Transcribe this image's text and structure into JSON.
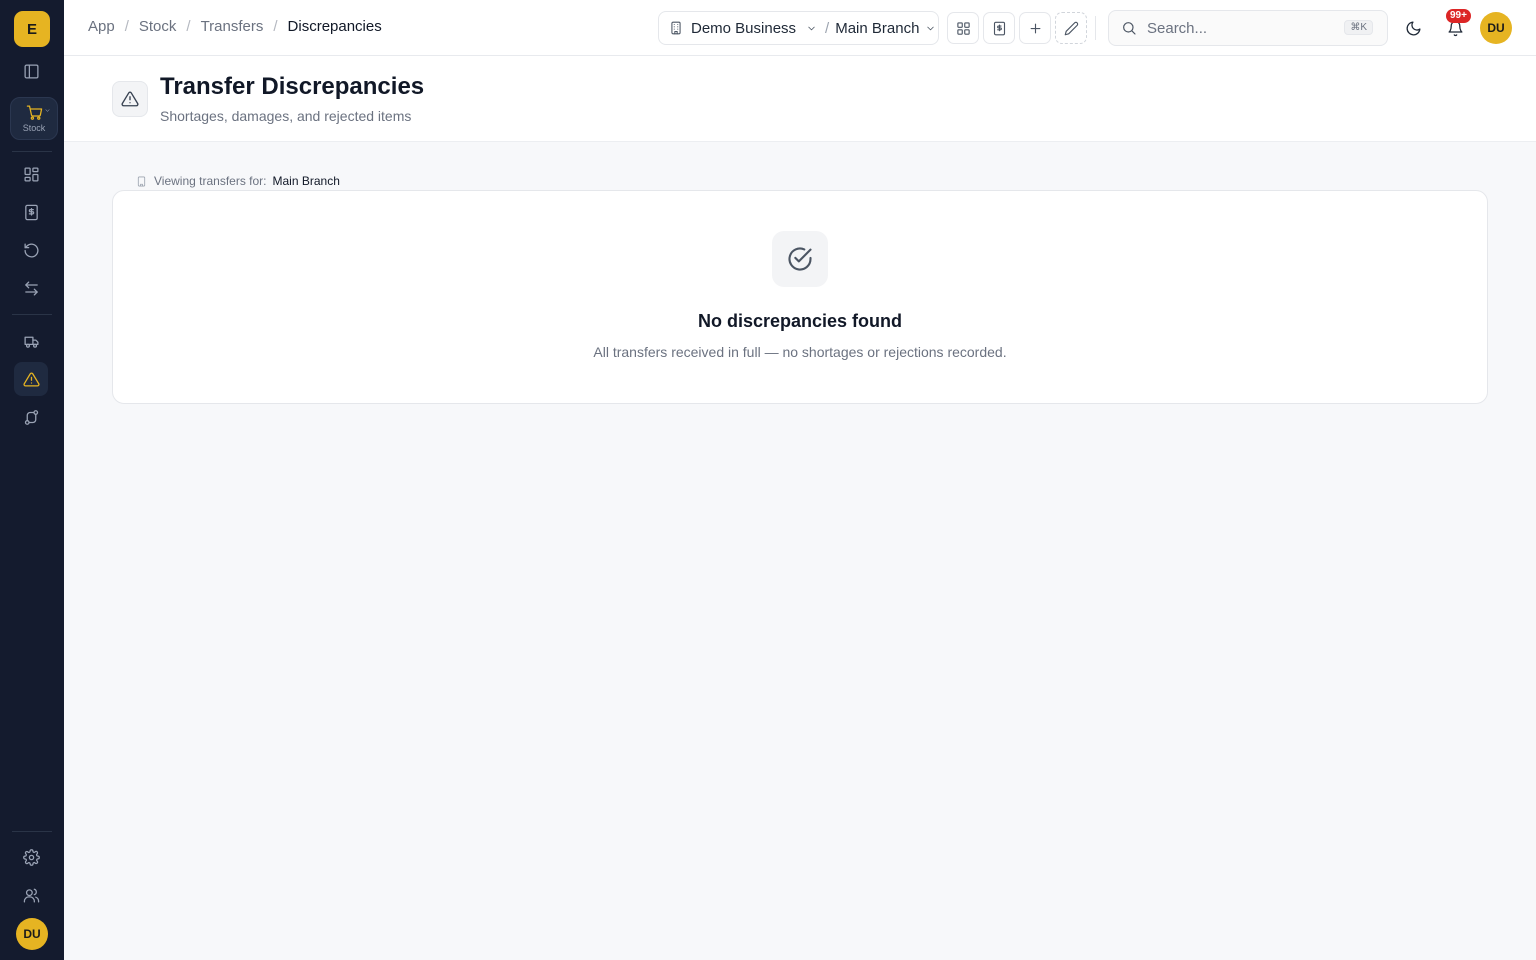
{
  "app": {
    "logo_letter": "E",
    "user_initials": "DU",
    "accent_color": "#e6b422",
    "sidebar_color": "#141b2e"
  },
  "sidebar": {
    "module_label": "Stock",
    "items": [
      {
        "icon": "panel-toggle-icon"
      },
      {
        "icon": "dashboard-grid-icon"
      },
      {
        "icon": "receipt-icon"
      },
      {
        "icon": "history-icon"
      },
      {
        "icon": "transfer-arrows-icon"
      },
      {
        "icon": "truck-icon"
      },
      {
        "icon": "alert-triangle-icon",
        "active": true
      },
      {
        "icon": "route-icon"
      },
      {
        "icon": "settings-gear-icon"
      },
      {
        "icon": "users-icon"
      }
    ]
  },
  "topbar": {
    "breadcrumbs": [
      "App",
      "Stock",
      "Transfers",
      "Discrepancies"
    ],
    "business": "Demo Business",
    "branch": "Main Branch",
    "search_placeholder": "Search...",
    "search_shortcut": "⌘K",
    "notification_count": "99+"
  },
  "header": {
    "title": "Transfer Discrepancies",
    "subtitle": "Shortages, damages, and rejected items"
  },
  "content": {
    "viewing_label": "Viewing transfers for:",
    "viewing_branch": "Main Branch",
    "empty_title": "No discrepancies found",
    "empty_description": "All transfers received in full — no shortages or rejections recorded."
  }
}
